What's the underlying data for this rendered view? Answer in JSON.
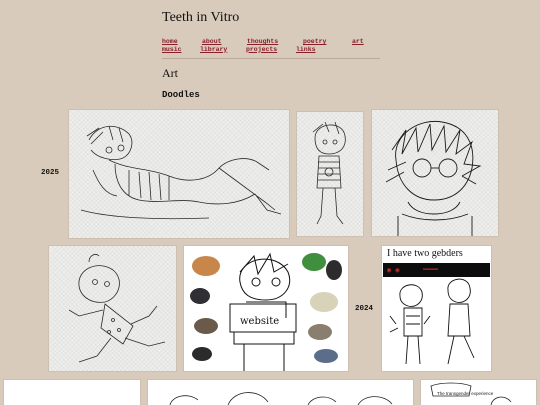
{
  "site": {
    "title": "Teeth in Vitro"
  },
  "nav": {
    "items": [
      {
        "label": "home"
      },
      {
        "label": "about"
      },
      {
        "label": "thoughts"
      },
      {
        "label": "poetry"
      },
      {
        "label": "art"
      },
      {
        "label": "music"
      },
      {
        "label": "library"
      },
      {
        "label": "projects"
      },
      {
        "label": "links"
      }
    ]
  },
  "page": {
    "heading": "Art",
    "subheading": "Doodles"
  },
  "gallery": {
    "year_2025": "2025",
    "year_2024": "2024",
    "artworks": [
      {
        "name": "reclining-figure-sketch"
      },
      {
        "name": "standing-figure-sketch"
      },
      {
        "name": "messy-hair-portrait-sketch"
      },
      {
        "name": "running-figure-sketch"
      },
      {
        "name": "website-birds-drawing"
      },
      {
        "name": "two-genders-drawing"
      },
      {
        "name": "bottom-left-drawing"
      },
      {
        "name": "bottom-center-drawing"
      },
      {
        "name": "bottom-right-drawing"
      }
    ],
    "two_genders_caption": "I have two gebders",
    "website_sign": "website",
    "bottom_right_caption": "The transgender experience"
  },
  "colors": {
    "background": "#d8cbbb",
    "link": "#8a1f2a",
    "text": "#111111"
  }
}
